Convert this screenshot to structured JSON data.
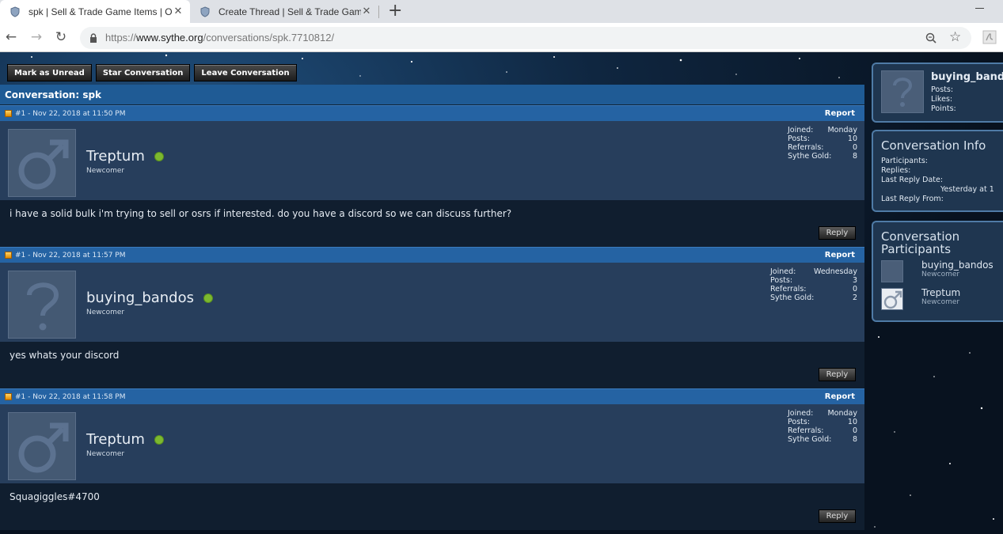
{
  "browser": {
    "tabs": [
      {
        "title": "spk | Sell & Trade Game Items | O",
        "active": true
      },
      {
        "title": "Create Thread | Sell & Trade Gam",
        "active": false
      }
    ],
    "url_scheme": "https://",
    "url_domain": "www.sythe.org",
    "url_path": "/conversations/spk.7710812/"
  },
  "actions": {
    "mark_unread": "Mark as Unread",
    "star": "Star Conversation",
    "leave": "Leave Conversation"
  },
  "conversation": {
    "title": "Conversation: spk",
    "report_label": "Report",
    "reply_label": "Reply",
    "messages": [
      {
        "header": "#1 - Nov 22, 2018 at 11:50 PM",
        "username": "Treptum",
        "rank": "Newcomer",
        "avatar": "male-icon",
        "stats": [
          {
            "label": "Joined:",
            "value": "Monday"
          },
          {
            "label": "Posts:",
            "value": "10"
          },
          {
            "label": "Referrals:",
            "value": "0"
          },
          {
            "label": "Sythe Gold:",
            "value": "8"
          }
        ],
        "text": "i have a solid bulk i'm trying to sell or osrs if interested. do you have a discord so we can discuss further?"
      },
      {
        "header": "#1 - Nov 22, 2018 at 11:57 PM",
        "username": "buying_bandos",
        "rank": "Newcomer",
        "avatar": "question-mark-icon",
        "stats": [
          {
            "label": "Joined:",
            "value": "Wednesday"
          },
          {
            "label": "Posts:",
            "value": "3"
          },
          {
            "label": "Referrals:",
            "value": "0"
          },
          {
            "label": "Sythe Gold:",
            "value": "2"
          }
        ],
        "text": "yes whats your discord"
      },
      {
        "header": "#1 - Nov 22, 2018 at 11:58 PM",
        "username": "Treptum",
        "rank": "Newcomer",
        "avatar": "male-icon",
        "stats": [
          {
            "label": "Joined:",
            "value": "Monday"
          },
          {
            "label": "Posts:",
            "value": "10"
          },
          {
            "label": "Referrals:",
            "value": "0"
          },
          {
            "label": "Sythe Gold:",
            "value": "8"
          }
        ],
        "text": "Squagiggles#4700"
      }
    ]
  },
  "sidebar": {
    "user": {
      "name": "buying_bandos",
      "posts_label": "Posts:",
      "likes_label": "Likes:",
      "points_label": "Points:"
    },
    "info": {
      "title": "Conversation Info",
      "participants_label": "Participants:",
      "replies_label": "Replies:",
      "last_reply_date_label": "Last Reply Date:",
      "last_reply_date_value": "Yesterday at 1",
      "last_reply_from_label": "Last Reply From:"
    },
    "participants": {
      "title_line1": "Conversation",
      "title_line2": "Participants",
      "items": [
        {
          "name": "buying_bandos",
          "rank": "Newcomer"
        },
        {
          "name": "Treptum",
          "rank": "Newcomer"
        }
      ]
    }
  },
  "colors": {
    "header_blue": "#2563a3",
    "online_green": "#7cb82f"
  }
}
